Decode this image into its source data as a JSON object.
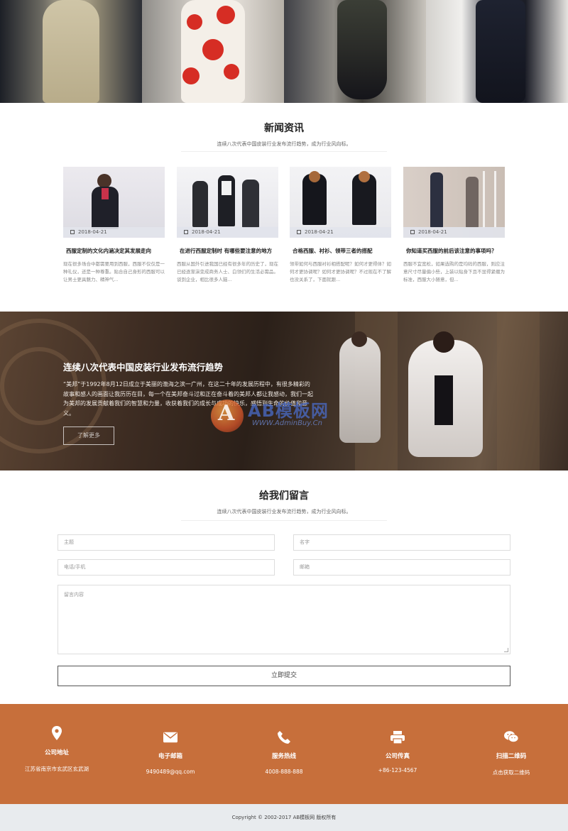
{
  "gallery": {
    "photos": [
      "fashion-photo-1",
      "fashion-photo-2",
      "fashion-photo-3",
      "fashion-photo-4"
    ]
  },
  "news": {
    "title": "新闻资讯",
    "subtitle": "连续八次代表中国皮装行业发布流行趋势，成为行业风向标。",
    "items": [
      {
        "date": "2018-04-21",
        "title": "西服定制的文化内涵决定其发展走向",
        "desc": "现在很多场合中都需要用到西服，西服不仅仅是一种礼仪，还是一种尊重。贴合自己身形的西服可以让男士更具魅力、精神气..."
      },
      {
        "date": "2018-04-21",
        "title": "在进行西服定制时 有哪些要注意的地方",
        "desc": "西服从国外引进我国已经有很多年的历史了，现在已经逐渐演变成商务人士、白领们的生活必需品。谈到企业，相比很多人脑..."
      },
      {
        "date": "2018-04-21",
        "title": "合格西服、衬衫、领带三者的搭配",
        "desc": "领带如何与西服衬衫相搭配呢？如何才更得体？如何才更协调呢？如何才更协调呢？不过现在不了解也没关系了，下面就跟..."
      },
      {
        "date": "2018-04-21",
        "title": "你知道买西服的前后该注意的事项吗？",
        "desc": "西服不宜宽松，如果选购的是均码的西服，则应注意尺寸尽量偏小些，上装以贴身下且不显得紧绷为标准，西服大小随意，但..."
      }
    ]
  },
  "banner": {
    "title": "连续八次代表中国皮装行业发布流行趋势",
    "text": "“美邦”于1992年8月12日成立于美丽的渤海之滨一广州，在这二十年的发展历程中，有很多精彩的故事和感人的画面让我历历在目，每一个在美邦奋斗过和正在奋斗着的美邦人都让我感动，我们一起为美邦的发展贡献着我们的智慧和力量，收获着我们的成长与成功的快乐，感悟到生命的价值和意义。",
    "button": "了解更多",
    "watermark_text": "AB模板网",
    "watermark_url": "WWW.AdminBuy.Cn"
  },
  "message": {
    "title": "给我们留言",
    "subtitle": "连续八次代表中国皮装行业发布流行趋势，成为行业风向标。",
    "subject_placeholder": "主题",
    "name_placeholder": "名字",
    "phone_placeholder": "电话/手机",
    "email_placeholder": "邮箱",
    "content_placeholder": "留言内容",
    "submit": "立即提交"
  },
  "contact": {
    "items": [
      {
        "icon": "map-pin-icon",
        "label": "公司地址",
        "value": "江苏省南京市玄武区玄武湖"
      },
      {
        "icon": "envelope-icon",
        "label": "电子邮箱",
        "value": "9490489@qq.com"
      },
      {
        "icon": "phone-icon",
        "label": "服务热线",
        "value": "4008-888-888"
      },
      {
        "icon": "printer-icon",
        "label": "公司传真",
        "value": "+86-123-4567"
      },
      {
        "icon": "wechat-icon",
        "label": "扫描二维码",
        "value": "点击获取二维码"
      }
    ]
  },
  "footer": {
    "copyright": "Copyright © 2002-2017 AB模板网 版权所有"
  },
  "colors": {
    "footer_bg": "#c76f3b",
    "copyright_bg": "#e8ebee"
  }
}
